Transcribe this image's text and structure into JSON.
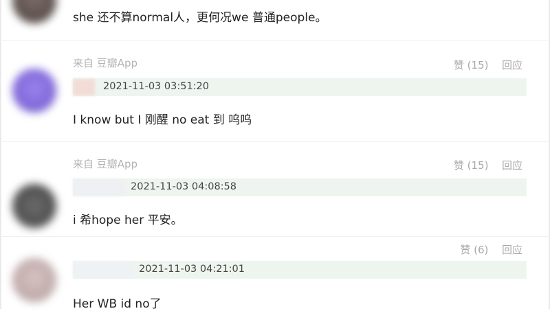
{
  "comments": [
    {
      "text": "she 还不算normal人，更何况we 普通people。"
    },
    {
      "source": "来自 豆瓣App",
      "like": "赞 (15)",
      "reply": "回应",
      "quote_time": "2021-11-03 03:51:20",
      "text": "I know but I 刚醒 no eat 到 呜呜"
    },
    {
      "source": "来自 豆瓣App",
      "like": "赞 (15)",
      "reply": "回应",
      "quote_time": "2021-11-03 04:08:58",
      "text": "i 希hope her 平安。"
    },
    {
      "like": "赞 (6)",
      "reply": "回应",
      "quote_time": "2021-11-03 04:21:01",
      "text": "Her WB id no了"
    }
  ],
  "colors": {
    "quote_background": "#eef5ef",
    "muted_text": "#a8a8a8",
    "source_text": "#b3b3b3",
    "body_text": "#222222"
  }
}
